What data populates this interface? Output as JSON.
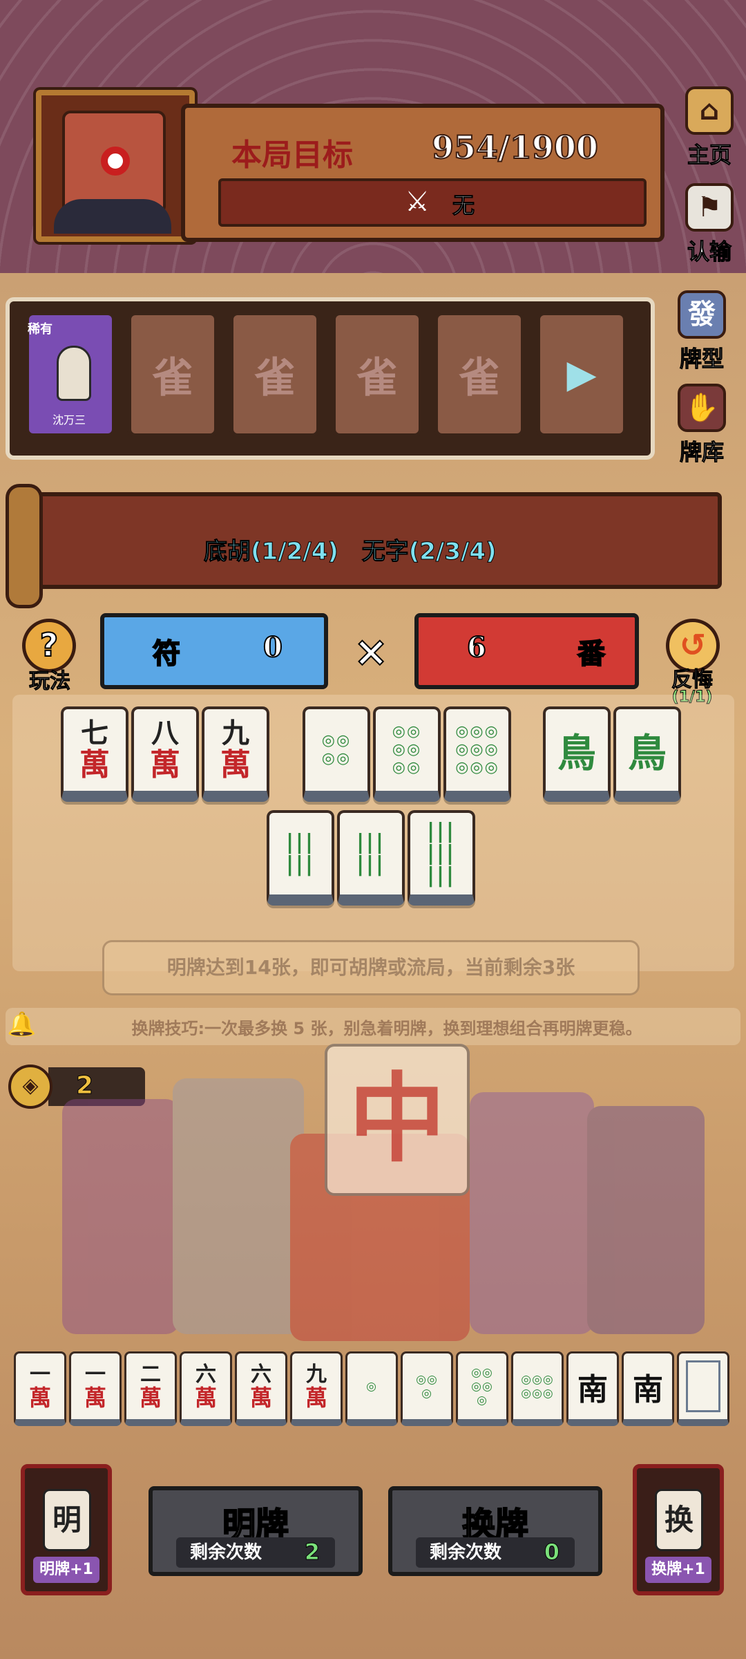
{
  "header": {
    "target_label": "本局目标",
    "target_value": "954/1900",
    "condition_text": "无",
    "home_label": "主页",
    "surrender_label": "认输"
  },
  "jokers": {
    "rare_badge": "稀有",
    "rare_name": "沈万三",
    "empty_glyph": "雀"
  },
  "side": {
    "hand_types_label": "牌型",
    "tile_library_label": "牌库"
  },
  "banner": {
    "hand_types": "底胡(1/2/4) 无字(2/3/4)"
  },
  "score": {
    "fu_label": "符",
    "fu_value": "0",
    "times": "×",
    "fan_value": "6",
    "fan_label": "番"
  },
  "help": {
    "rules_label": "玩法",
    "undo_label": "反悔",
    "undo_count": "(1/1)"
  },
  "revealed_tiles": [
    {
      "kind": "wan",
      "num": "七",
      "suit": "萬"
    },
    {
      "kind": "wan",
      "num": "八",
      "suit": "萬"
    },
    {
      "kind": "wan",
      "num": "九",
      "suit": "萬"
    },
    {
      "kind": "dots",
      "dots": "◎◎\n◎◎"
    },
    {
      "kind": "dots",
      "dots": "◎◎\n◎◎\n◎◎"
    },
    {
      "kind": "dots",
      "dots": "◎◎◎\n◎◎◎\n◎◎◎"
    },
    {
      "kind": "bird",
      "glyph": "鳥"
    },
    {
      "kind": "bird",
      "glyph": "鳥"
    },
    {
      "kind": "bam",
      "bam": "|||\n|||"
    },
    {
      "kind": "bam",
      "bam": "|||\n|||"
    },
    {
      "kind": "bam",
      "bam": "|||\n|||\n|||"
    }
  ],
  "hints": {
    "reveal_hint": "明牌达到14张，即可胡牌或流局，当前剩余3张",
    "swap_tip": "换牌技巧:一次最多换 5 张，别急着明牌，换到理想组合再明牌更稳。"
  },
  "coins": {
    "count": "2"
  },
  "scene": {
    "big_tile": "中"
  },
  "hand_tiles": [
    {
      "kind": "wan",
      "num": "一",
      "suit": "萬"
    },
    {
      "kind": "wan",
      "num": "一",
      "suit": "萬"
    },
    {
      "kind": "wan",
      "num": "二",
      "suit": "萬"
    },
    {
      "kind": "wan",
      "num": "六",
      "suit": "萬"
    },
    {
      "kind": "wan",
      "num": "六",
      "suit": "萬"
    },
    {
      "kind": "wan",
      "num": "九",
      "suit": "萬"
    },
    {
      "kind": "dots",
      "dots": "◎"
    },
    {
      "kind": "dots",
      "dots": "◎◎\n◎"
    },
    {
      "kind": "dots",
      "dots": "◎◎\n◎◎\n◎"
    },
    {
      "kind": "dots",
      "dots": "◎◎◎\n◎◎◎"
    },
    {
      "kind": "wind",
      "glyph": "南"
    },
    {
      "kind": "wind",
      "glyph": "南"
    },
    {
      "kind": "blank",
      "glyph": ""
    }
  ],
  "actions": {
    "reveal_title": "明牌",
    "remaining_label": "剩余次数",
    "reveal_remaining": "2",
    "swap_title": "换牌",
    "swap_remaining": "0"
  },
  "power_cards": {
    "left_label": "明牌+1",
    "left_glyph": "明",
    "right_label": "换牌+1",
    "right_glyph": "换"
  }
}
